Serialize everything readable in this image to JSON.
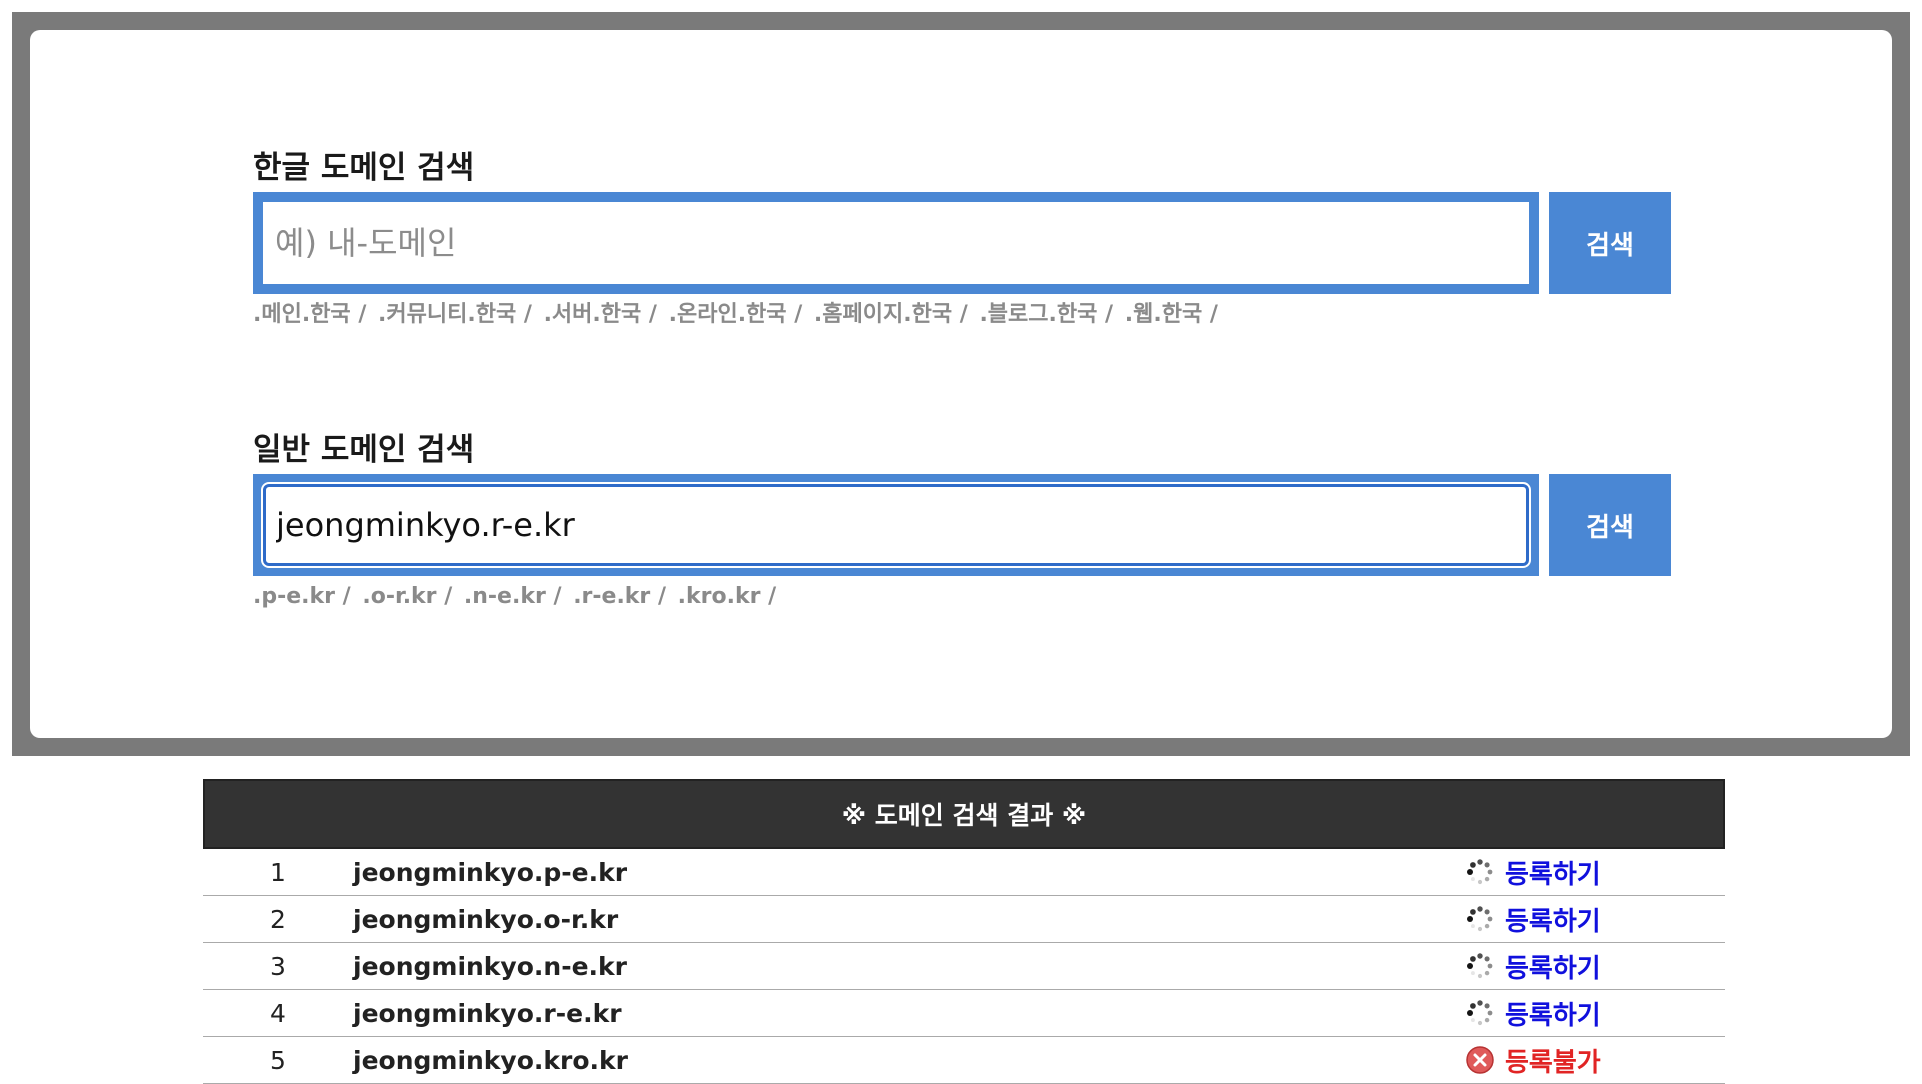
{
  "korean_search": {
    "title": "한글 도메인 검색",
    "placeholder": "예) 내-도메인",
    "value": "",
    "button_label": "검색",
    "tlds": [
      ".메인.한국 /",
      ".커뮤니티.한국 /",
      ".서버.한국 /",
      ".온라인.한국 /",
      ".홈페이지.한국 /",
      ".블로그.한국 /",
      ".웹.한국 /"
    ]
  },
  "general_search": {
    "title": "일반 도메인 검색",
    "placeholder": "",
    "value": "jeongminkyo.r-e.kr",
    "button_label": "검색",
    "tlds": [
      ".p-e.kr /",
      ".o-r.kr /",
      ".n-e.kr /",
      ".r-e.kr /",
      ".kro.kr /"
    ]
  },
  "results": {
    "header": "※ 도메인 검색 결과 ※",
    "rows": [
      {
        "num": "1",
        "domain": "jeongminkyo.p-e.kr",
        "status": "등록하기",
        "icon": "loading-spinner-icon"
      },
      {
        "num": "2",
        "domain": "jeongminkyo.o-r.kr",
        "status": "등록하기",
        "icon": "loading-spinner-icon"
      },
      {
        "num": "3",
        "domain": "jeongminkyo.n-e.kr",
        "status": "등록하기",
        "icon": "loading-spinner-icon"
      },
      {
        "num": "4",
        "domain": "jeongminkyo.r-e.kr",
        "status": "등록하기",
        "icon": "loading-spinner-icon"
      },
      {
        "num": "5",
        "domain": "jeongminkyo.kro.kr",
        "status": "등록불가",
        "icon": "error-x-icon"
      }
    ]
  },
  "colors": {
    "accent": "#4a87d4",
    "frame": "#7a7a7a",
    "header_bg": "#333333",
    "available": "#1010dd",
    "unavailable": "#e12424"
  }
}
